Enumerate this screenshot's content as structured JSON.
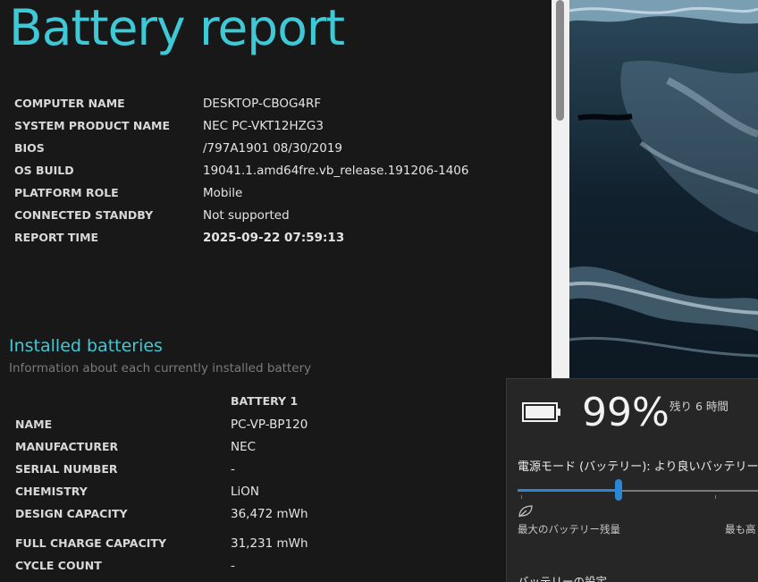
{
  "report": {
    "title": "Battery report",
    "system_info": [
      {
        "key": "COMPUTER NAME",
        "value": "DESKTOP-CBOG4RF"
      },
      {
        "key": "SYSTEM PRODUCT NAME",
        "value": "NEC PC-VKT12HZG3"
      },
      {
        "key": "BIOS",
        "value": "/797A1901 08/30/2019"
      },
      {
        "key": "OS BUILD",
        "value": "19041.1.amd64fre.vb_release.191206-1406"
      },
      {
        "key": "PLATFORM ROLE",
        "value": "Mobile"
      },
      {
        "key": "CONNECTED STANDBY",
        "value": "Not supported"
      },
      {
        "key": "REPORT TIME",
        "value": "2025-09-22  07:59:13"
      }
    ],
    "installed_batteries": {
      "title": "Installed batteries",
      "subtitle": "Information about each currently installed battery",
      "column_header": "BATTERY 1",
      "rows": [
        {
          "key": "NAME",
          "value": "PC-VP-BP120"
        },
        {
          "key": "MANUFACTURER",
          "value": "NEC"
        },
        {
          "key": "SERIAL NUMBER",
          "value": "-"
        },
        {
          "key": "CHEMISTRY",
          "value": "LiON"
        },
        {
          "key": "DESIGN CAPACITY",
          "value": "36,472 mWh"
        },
        {
          "key": "FULL CHARGE CAPACITY",
          "value": "31,231 mWh"
        },
        {
          "key": "CYCLE COUNT",
          "value": "-"
        }
      ]
    }
  },
  "battery_flyout": {
    "percent": "99%",
    "remaining": "残り 6 時間",
    "power_mode_label": "電源モード (バッテリー): より良いバッテリー",
    "slider_level": 0.39,
    "slider_left_label": "最大のバッテリー残量",
    "slider_right_label": "最も高し",
    "settings_link": "バッテリーの設定"
  },
  "colors": {
    "accent_cyan": "#3fc8d6",
    "slider_blue": "#2a87d4",
    "report_bg": "#181818",
    "flyout_bg": "#262626"
  }
}
